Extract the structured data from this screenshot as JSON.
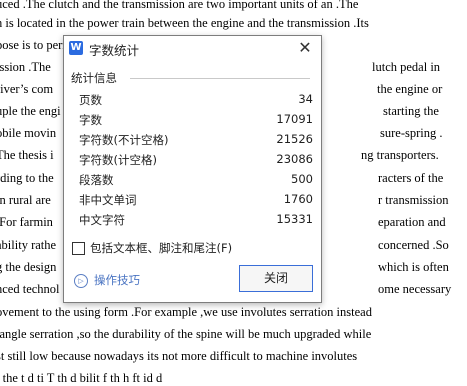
{
  "document": {
    "lines": [
      "uced .The clutch and the transmission are two important units of an .The",
      "n is located in the power train between the engine and the transmission .Its",
      "pose is to perm",
      "ission .The",
      "river’s com",
      "uple the engi",
      "obile movin",
      "The thesis i",
      "rding to the",
      "in rural are",
      ".For farmin",
      "ability rathe",
      "g the design",
      "nced technol",
      "ovement to the using form .For example ,we use involutes serration instead",
      "tangle serration ,so the durability of the spine will be much upgraded while",
      "st still low because nowadays its not more difficult to machine involutes",
      "i  the  t   d    ti      T    th  d   bilit   f th   h ft       id   d"
    ],
    "right_fragments": [
      "lutch pedal in",
      "the engine or",
      "starting the",
      "sure-spring .",
      "ng transporters.",
      "racters of the",
      "r transmission",
      "eparation and",
      "concerned .So",
      "which is often",
      "ome necessary"
    ]
  },
  "dialog": {
    "app_icon": "W",
    "title": "字数统计",
    "close_icon": "close-icon",
    "close_glyph": "✕",
    "group_label": "统计信息",
    "stats": [
      {
        "label": "页数",
        "value": "34"
      },
      {
        "label": "字数",
        "value": "17091"
      },
      {
        "label": "字符数(不计空格)",
        "value": "21526"
      },
      {
        "label": "字符数(计空格)",
        "value": "23086"
      },
      {
        "label": "段落数",
        "value": "500"
      },
      {
        "label": "非中文单词",
        "value": "1760"
      },
      {
        "label": "中文字符",
        "value": "15331"
      }
    ],
    "checkbox_label": "包括文本框、脚注和尾注(F)",
    "checkbox_checked": false,
    "tips_icon": "play-circle-icon",
    "tips_glyph": "▷",
    "tips_label": "操作技巧",
    "close_button_label": "关闭",
    "accent_color": "#3a6ed8",
    "link_color": "#4a74c2"
  }
}
